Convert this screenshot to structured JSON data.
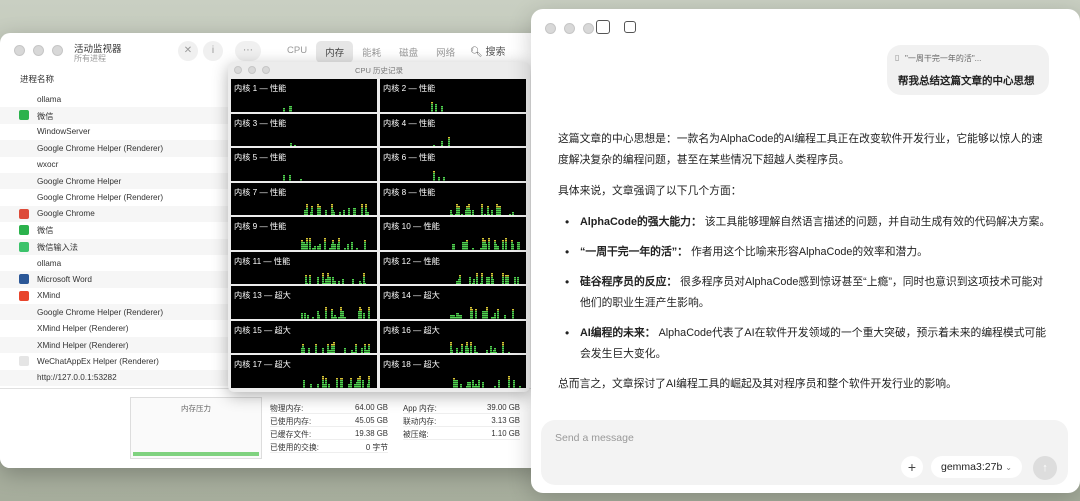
{
  "activity_monitor": {
    "title": "活动监视器",
    "subtitle": "所有进程",
    "tabs": [
      "CPU",
      "内存",
      "能耗",
      "磁盘",
      "网络"
    ],
    "active_tab": "内存",
    "search_label": "搜索",
    "column_header": "进程名称",
    "processes": [
      {
        "name": "ollama",
        "icon": ""
      },
      {
        "name": "微信",
        "icon": "wechat-icon",
        "color": "#2bb24c"
      },
      {
        "name": "WindowServer",
        "icon": ""
      },
      {
        "name": "Google Chrome Helper (Renderer)",
        "icon": ""
      },
      {
        "name": "wxocr",
        "icon": ""
      },
      {
        "name": "Google Chrome Helper",
        "icon": ""
      },
      {
        "name": "Google Chrome Helper (Renderer)",
        "icon": ""
      },
      {
        "name": "Google Chrome",
        "icon": "chrome-icon",
        "color": "#dd4b39"
      },
      {
        "name": "微信",
        "icon": "wechat-icon",
        "color": "#2bb24c"
      },
      {
        "name": "微信输入法",
        "icon": "wechat-input-icon",
        "color": "#3cc36b"
      },
      {
        "name": "ollama",
        "icon": ""
      },
      {
        "name": "Microsoft Word",
        "icon": "word-icon",
        "color": "#2b5797"
      },
      {
        "name": "XMind",
        "icon": "xmind-icon",
        "color": "#e8452c"
      },
      {
        "name": "Google Chrome Helper (Renderer)",
        "icon": ""
      },
      {
        "name": "XMind Helper (Renderer)",
        "icon": ""
      },
      {
        "name": "XMind Helper (Renderer)",
        "icon": ""
      },
      {
        "name": "WeChatAppEx Helper (Renderer)",
        "icon": "wechat-app-icon",
        "color": "#e5e5e5"
      },
      {
        "name": "http://127.0.0.1:53282",
        "icon": ""
      }
    ],
    "memory_pressure_title": "内存压力",
    "stats_left": [
      {
        "label": "物理内存:",
        "value": "64.00 GB"
      },
      {
        "label": "已使用内存:",
        "value": "45.05 GB"
      },
      {
        "label": "已缓存文件:",
        "value": "19.38 GB"
      },
      {
        "label": "已使用的交换:",
        "value": "0 字节"
      }
    ],
    "stats_right": [
      {
        "label": "App 内存:",
        "value": "39.00 GB"
      },
      {
        "label": "联动内存:",
        "value": "3.13 GB"
      },
      {
        "label": "被压缩:",
        "value": "1.10 GB"
      }
    ]
  },
  "cpu_history": {
    "title": "CPU 历史记录",
    "cores": [
      "内核 1 — 性能",
      "内核 2 — 性能",
      "内核 3 — 性能",
      "内核 4 — 性能",
      "内核 5 — 性能",
      "内核 6 — 性能",
      "内核 7 — 性能",
      "内核 8 — 性能",
      "内核 9 — 性能",
      "内核 10 — 性能",
      "内核 11 — 性能",
      "内核 12 — 性能",
      "内核 13 — 超大",
      "内核 14 — 超大",
      "内核 15 — 超大",
      "内核 16 — 超大",
      "内核 17 — 超大",
      "内核 18 — 超大"
    ]
  },
  "chat": {
    "attachment_name": "\"一周干完一年的活\"...",
    "user_message": "帮我总结这篇文章的中心思想",
    "answer_intro": "这篇文章的中心思想是：一款名为AlphaCode的AI编程工具正在改变软件开发行业，它能够以惊人的速度解决复杂的编程问题，甚至在某些情况下超越人类程序员。",
    "answer_lead": "具体来说，文章强调了以下几个方面：",
    "points": [
      {
        "title": "AlphaCode的强大能力：",
        "text": " 该工具能够理解自然语言描述的问题，并自动生成有效的代码解决方案。"
      },
      {
        "title": "“一周干完一年的活”：",
        "text": " 作者用这个比喻来形容AlphaCode的效率和潜力。"
      },
      {
        "title": "硅谷程序员的反应：",
        "text": " 很多程序员对AlphaCode感到惊讶甚至“上瘾”，同时也意识到这项技术可能对他们的职业生涯产生影响。"
      },
      {
        "title": "AI编程的未来：",
        "text": " AlphaCode代表了AI在软件开发领域的一个重大突破，预示着未来的编程模式可能会发生巨大变化。"
      }
    ],
    "answer_outro": "总而言之，文章探讨了AI编程工具的崛起及其对程序员和整个软件开发行业的影响。",
    "input_placeholder": "Send a message",
    "model": "gemma3:27b"
  }
}
